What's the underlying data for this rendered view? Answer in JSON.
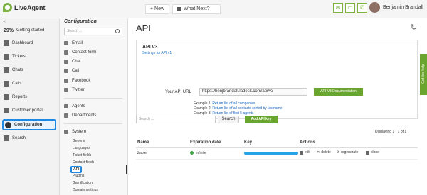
{
  "app": {
    "name": "LiveAgent"
  },
  "topbar": {
    "tabs": [
      {
        "label": "+ New"
      },
      {
        "label": "What Next?"
      }
    ],
    "user_name": "Benjamin Brandall"
  },
  "leftnav": {
    "progress_percent": "29%",
    "items": [
      {
        "label": "Getting started"
      },
      {
        "label": "Dashboard"
      },
      {
        "label": "Tickets"
      },
      {
        "label": "Chats"
      },
      {
        "label": "Calls"
      },
      {
        "label": "Reports"
      },
      {
        "label": "Customer portal"
      },
      {
        "label": "Configuration"
      },
      {
        "label": "Search"
      }
    ]
  },
  "config": {
    "title": "Configuration",
    "search_placeholder": "Search ...",
    "items": [
      {
        "label": "Email"
      },
      {
        "label": "Contact form"
      },
      {
        "label": "Chat"
      },
      {
        "label": "Call"
      },
      {
        "label": "Facebook"
      },
      {
        "label": "Twitter"
      },
      {
        "label": "Agents"
      },
      {
        "label": "Departments"
      },
      {
        "label": "System"
      }
    ],
    "system_sub": [
      {
        "label": "General"
      },
      {
        "label": "Languages"
      },
      {
        "label": "Ticket fields"
      },
      {
        "label": "Contact fields"
      },
      {
        "label": "API"
      },
      {
        "label": "Plugins"
      },
      {
        "label": "Gamification"
      },
      {
        "label": "Domain settings"
      }
    ]
  },
  "main": {
    "title": "API",
    "api_box": {
      "title": "API v3",
      "settings_link": "Settings for API v1",
      "url_label": "Your API URL",
      "url_value": "https://benjbrandall.ladesk.com/api/v3",
      "doc_button": "API V3 Documentation",
      "examples": [
        {
          "prefix": "Example 1:",
          "link": "Return list of all companies"
        },
        {
          "prefix": "Example 2:",
          "link": "Return list of all contacts sorted by lastname"
        },
        {
          "prefix": "Example 3:",
          "link": "Return list of first 5 agents"
        }
      ]
    },
    "search_placeholder": "Search ...",
    "search_button": "Search",
    "add_button": "Add API key",
    "displaying": "Displaying 1 - 1 of 1",
    "columns": [
      "Name",
      "Expiration date",
      "Key",
      "Actions"
    ],
    "rows": [
      {
        "name": "Zapier",
        "expiration": "Infinite",
        "actions": [
          "edit",
          "delete",
          "regenerate",
          "clone"
        ]
      }
    ]
  },
  "live_help": "Get live help"
}
